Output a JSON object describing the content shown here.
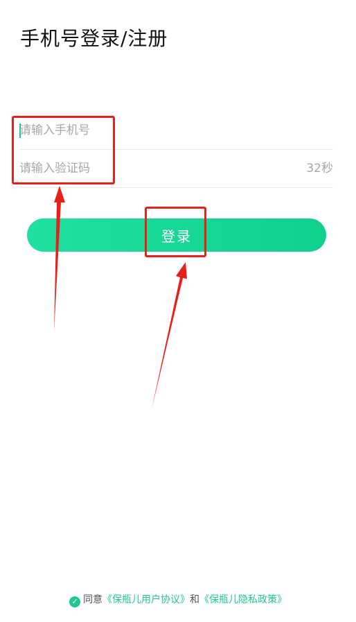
{
  "header": {
    "title": "手机号登录/注册"
  },
  "form": {
    "phone_placeholder": "请输入手机号",
    "code_placeholder": "请输入验证码",
    "countdown": "32秒",
    "login_label": "登录"
  },
  "footer": {
    "agree_text": "同意",
    "user_agreement": "《保瓶儿用户协议》",
    "and_text": "和",
    "privacy_policy": "《保瓶儿隐私政策》"
  },
  "colors": {
    "accent": "#1fc98d",
    "annotation": "#e8201a"
  },
  "icons": [
    "check-circle-icon"
  ]
}
